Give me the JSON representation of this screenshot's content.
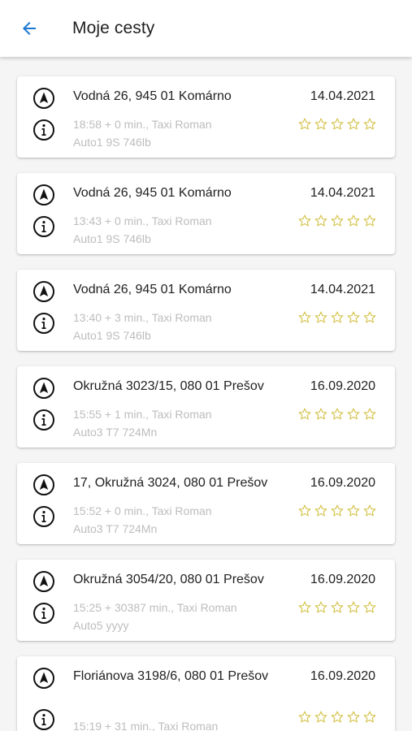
{
  "header": {
    "title": "Moje cesty",
    "back_icon": "arrow-back-icon",
    "accent": "#1976d2"
  },
  "colors": {
    "star_outline": "#d4c24a",
    "meta_text": "#bdbdbd"
  },
  "trips": [
    {
      "address": "Vodná 26, 945 01 Komárno",
      "date": "14.04.2021",
      "meta1": "18:58 + 0 min., Taxi Roman",
      "meta2": "Auto1 9S 746lb",
      "rating": 0
    },
    {
      "address": "Vodná 26, 945 01 Komárno",
      "date": "14.04.2021",
      "meta1": "13:43 + 0 min., Taxi Roman",
      "meta2": "Auto1 9S 746lb",
      "rating": 0
    },
    {
      "address": "Vodná 26, 945 01 Komárno",
      "date": "14.04.2021",
      "meta1": "13:40 + 3 min., Taxi Roman",
      "meta2": "Auto1 9S 746lb",
      "rating": 0
    },
    {
      "address": "Okružná 3023/15, 080 01 Prešov",
      "date": "16.09.2020",
      "meta1": "15:55 + 1 min., Taxi Roman",
      "meta2": "Auto3 T7 724Mn",
      "rating": 0
    },
    {
      "address": "17, Okružná 3024, 080 01 Prešov",
      "date": "16.09.2020",
      "meta1": "15:52 + 0 min., Taxi Roman",
      "meta2": "Auto3 T7 724Mn",
      "rating": 0
    },
    {
      "address": "Okružná 3054/20, 080 01 Prešov",
      "date": "16.09.2020",
      "meta1": "15:25 + 30387 min., Taxi Roman",
      "meta2": "Auto5 yyyy",
      "rating": 0
    },
    {
      "address": "Floriánova 3198/6, 080 01 Prešov",
      "date": "16.09.2020",
      "meta1": "15:19 + 31 min., Taxi Roman",
      "meta2": "",
      "rating": 0
    }
  ]
}
